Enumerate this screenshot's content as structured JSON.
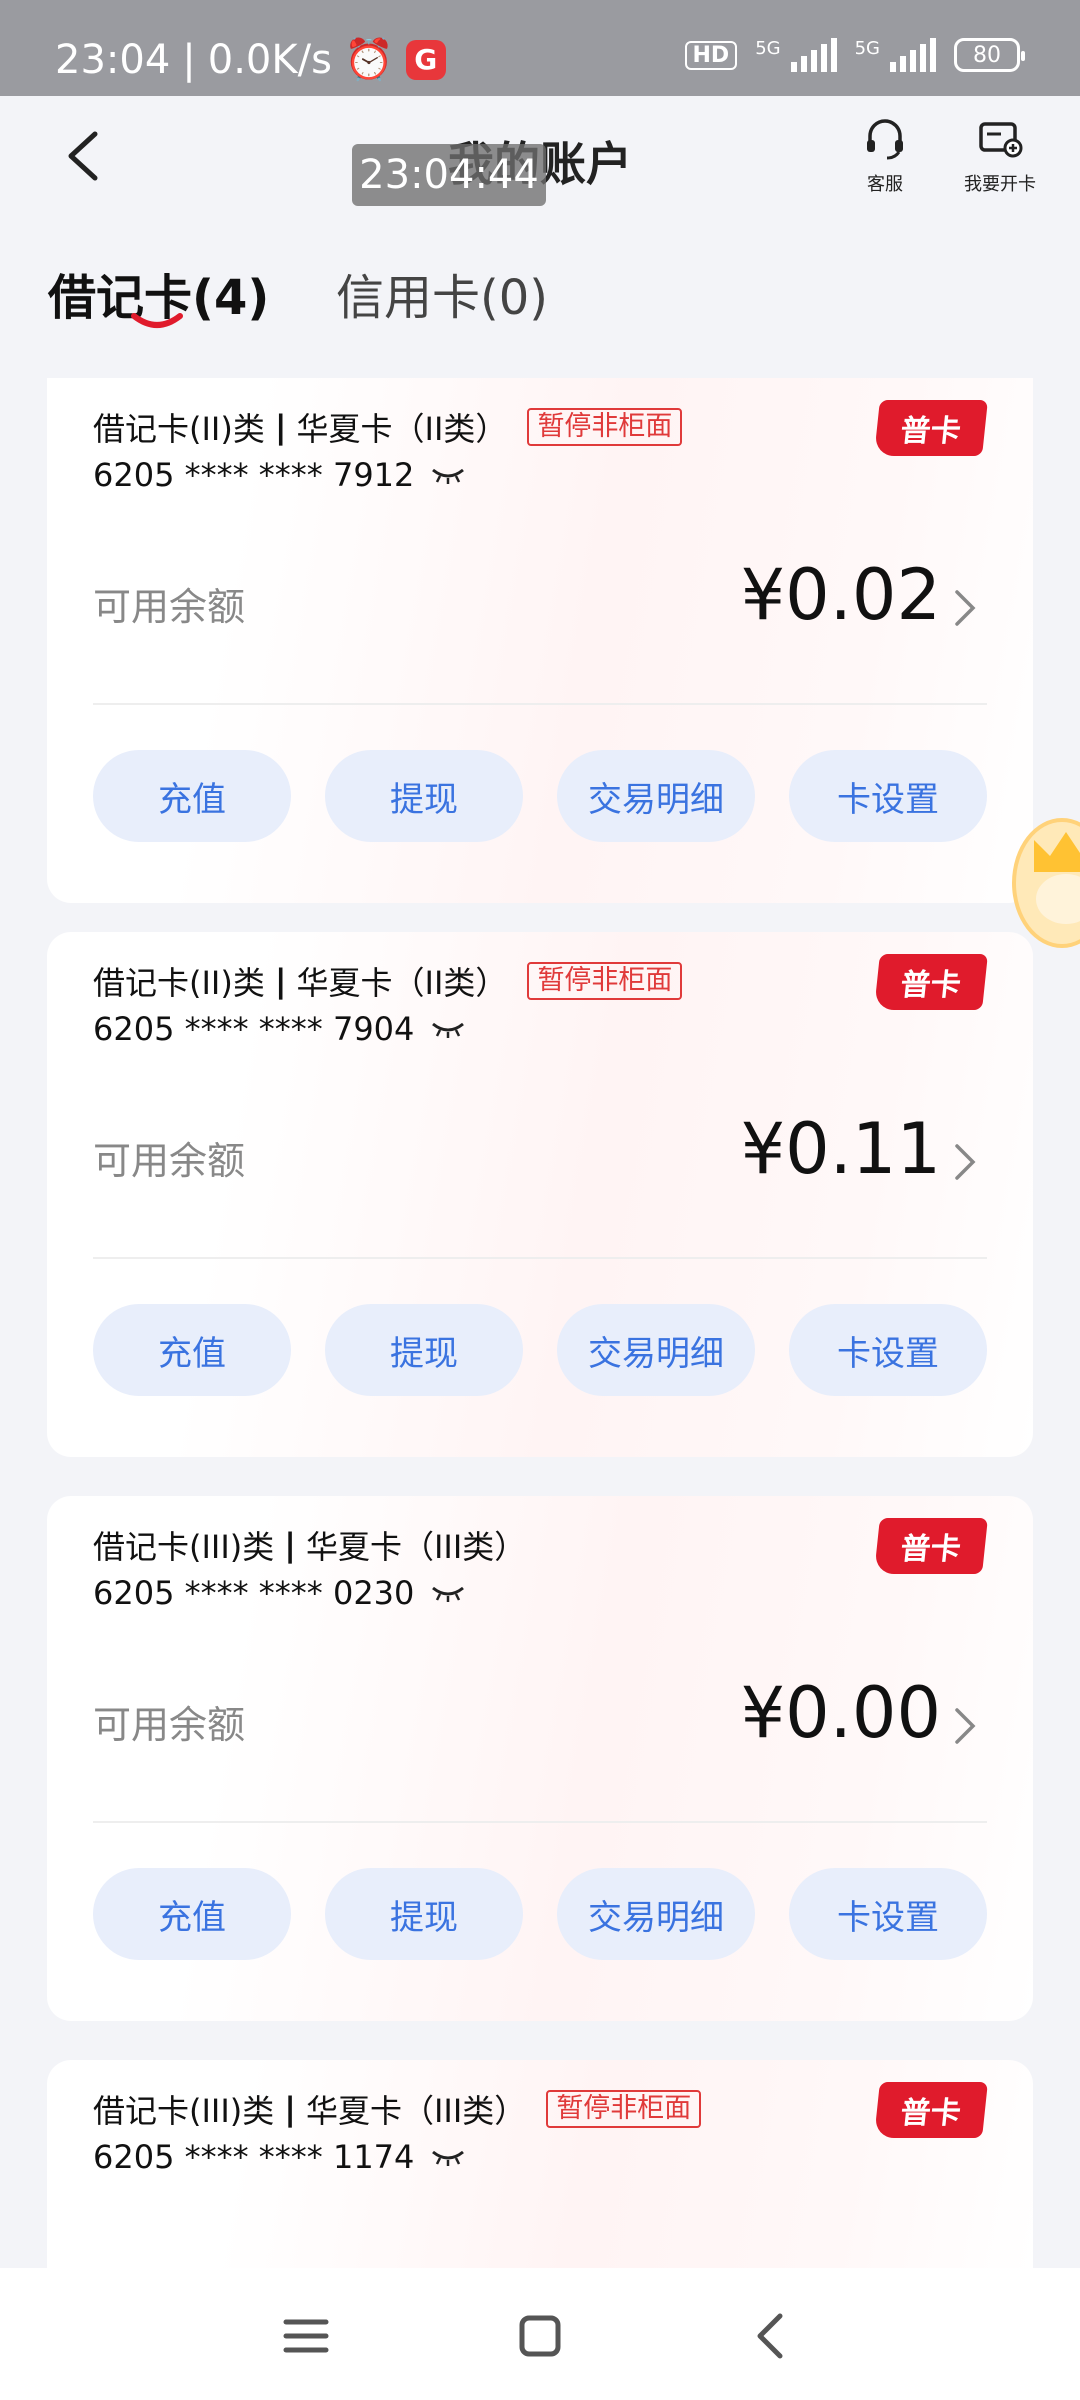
{
  "status_bar": {
    "time": "23:04",
    "network_speed": "0.0K/s",
    "app_badge": "G",
    "hd_label": "HD",
    "signal_1": "5G",
    "signal_2": "5G",
    "battery": "80"
  },
  "header": {
    "title": "我的账户",
    "time_overlay": "23:04:44",
    "service_label": "客服",
    "open_card_label": "我要开卡"
  },
  "tabs": [
    {
      "label": "借记卡(4)",
      "active": true
    },
    {
      "label": "信用卡(0)",
      "active": false
    }
  ],
  "cards": [
    {
      "type": "借记卡(II)类",
      "separator": "|",
      "name": "华夏卡（II类）",
      "tag": "暂停非柜面",
      "number": "6205 **** **** 7912",
      "badge": "普卡",
      "balance_label": "可用余额",
      "balance": "¥0.02",
      "actions": [
        "充值",
        "提现",
        "交易明细",
        "卡设置"
      ]
    },
    {
      "type": "借记卡(II)类",
      "separator": "|",
      "name": "华夏卡（II类）",
      "tag": "暂停非柜面",
      "number": "6205 **** **** 7904",
      "badge": "普卡",
      "balance_label": "可用余额",
      "balance": "¥0.11",
      "actions": [
        "充值",
        "提现",
        "交易明细",
        "卡设置"
      ]
    },
    {
      "type": "借记卡(III)类",
      "separator": "|",
      "name": "华夏卡（III类）",
      "tag": "",
      "number": "6205 **** **** 0230",
      "badge": "普卡",
      "balance_label": "可用余额",
      "balance": "¥0.00",
      "actions": [
        "充值",
        "提现",
        "交易明细",
        "卡设置"
      ]
    },
    {
      "type": "借记卡(III)类",
      "separator": "|",
      "name": "华夏卡（III类）",
      "tag": "暂停非柜面",
      "number": "6205 **** **** 1174",
      "badge": "普卡",
      "balance_label": "",
      "balance": "",
      "actions": []
    }
  ],
  "colors": {
    "accent_red": "#e01b2c",
    "action_blue": "#3a73e0",
    "action_bg": "#e8eefb",
    "page_bg": "#f3f4f8"
  }
}
